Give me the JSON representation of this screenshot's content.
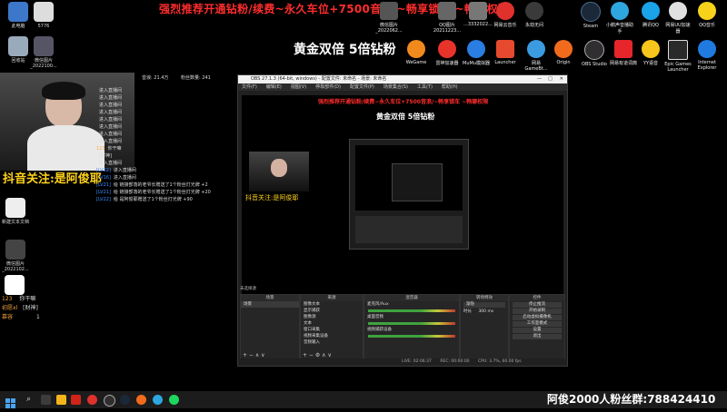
{
  "banner": {
    "line1": "强烈推荐开通钻粉/续费~永久车位+7500音浪/~畅享锁车 ~畅聊权限",
    "line2": "黄金双倍 5倍钻粉",
    "follow": "抖音关注:是阿俊耶",
    "fans": "阿俊2000人粉丝群:788424410"
  },
  "desktop_left": [
    {
      "label": "此电脑",
      "icon": "computer-icon"
    },
    {
      "label": "5776",
      "icon": "file-icon"
    },
    {
      "label": "回收站",
      "icon": "recycle-bin-icon"
    },
    {
      "label": "微信图片_2022100...",
      "icon": "image-icon"
    },
    {
      "label": "新建文本文档",
      "icon": "text-file-icon"
    },
    {
      "label": "微信图片_2022102...",
      "icon": "image-icon"
    }
  ],
  "desktop_top_row": [
    {
      "label": "微信图片_2022062...",
      "icon": "image-icon"
    },
    {
      "label": "QQ图片 20211223...",
      "icon": "image-icon"
    },
    {
      "label": "...3332022...",
      "icon": "image-icon"
    },
    {
      "label": "网易云音乐",
      "icon": "netease-music-icon"
    },
    {
      "label": "永劫无间",
      "icon": "game-icon"
    },
    {
      "label": "Steam",
      "icon": "steam-icon"
    },
    {
      "label": "小鹅声音播助手",
      "icon": "app-icon"
    },
    {
      "label": "腾讯QQ",
      "icon": "qq-icon"
    },
    {
      "label": "网易UU加速器",
      "icon": "uu-icon"
    },
    {
      "label": "QQ音乐",
      "icon": "qq-music-icon"
    }
  ],
  "desktop_second_row": [
    {
      "label": "WeGame",
      "icon": "wegame-icon"
    },
    {
      "label": "雷神加速器",
      "icon": "thunder-icon"
    },
    {
      "label": "MuMu模拟器",
      "icon": "mumu-icon"
    },
    {
      "label": "Launcher",
      "icon": "launcher-icon"
    },
    {
      "label": "网易GameBt...",
      "icon": "game-icon"
    },
    {
      "label": "Origin",
      "icon": "origin-icon"
    },
    {
      "label": "OBS Studio",
      "icon": "obs-icon"
    },
    {
      "label": "网易有道词典",
      "icon": "youdao-icon"
    },
    {
      "label": "YY语音",
      "icon": "yy-icon"
    },
    {
      "label": "Epic Games Launcher",
      "icon": "epic-icon"
    },
    {
      "label": "Internet Explorer",
      "icon": "ie-icon"
    }
  ],
  "stream_stats": {
    "left": "音浪: 21.4万",
    "right": "粉丝数量: 241"
  },
  "chat": [
    {
      "lv": "",
      "name": "",
      "text": "进入直播间"
    },
    {
      "lv": "",
      "name": "",
      "text": "进入直播间"
    },
    {
      "lv": "",
      "name": "",
      "text": "进入直播间"
    },
    {
      "lv": "",
      "name": "",
      "text": "进入直播间"
    },
    {
      "lv": "",
      "name": "",
      "text": "进入直播间"
    },
    {
      "lv": "",
      "name": "",
      "text": "进入直播间"
    },
    {
      "lv": "",
      "name": "",
      "text": "进入直播间"
    },
    {
      "lv": "",
      "name": "",
      "text": "进入直播间"
    },
    {
      "lv": "",
      "name": "123",
      "text": "你干嘛"
    },
    {
      "lv": "",
      "name": "",
      "text": "[财神]"
    },
    {
      "lv": "",
      "name": "",
      "text": "进入直播间"
    },
    {
      "lv": "[LV22]",
      "name": "",
      "text": "进入直播间"
    },
    {
      "lv": "[LV16]",
      "name": "",
      "text": "进入直播间"
    },
    {
      "lv": "[LV21]",
      "name": "",
      "text": "给 链接部落的老爷长赠送了1个粉丝灯光牌 +2"
    },
    {
      "lv": "[LV21]",
      "name": "",
      "text": "给 链接部落的老爷长赠送了1个粉丝灯光牌 +20"
    },
    {
      "lv": "[LV22]",
      "name": "",
      "text": "给 是阿俊耶赠送了1个粉丝灯光牌 +90"
    }
  ],
  "bottom_chat": [
    {
      "name": "123",
      "text": "你干嘛"
    },
    {
      "name": "初愿xl",
      "text": "[财神]"
    },
    {
      "name": "慕容",
      "text": "1"
    }
  ],
  "obs": {
    "title": "OBS 27.1.3 (64-bit, windows) - 配置文件: 未命名 - 场景: 未命名",
    "menu": [
      "文件(F)",
      "编辑(E)",
      "视图(V)",
      "停靠部件(D)",
      "配置文件(P)",
      "场景集合(S)",
      "工具(T)",
      "帮助(H)"
    ],
    "scene_label": "未选择源",
    "docks": {
      "scenes": {
        "title": "场景",
        "items": [
          "场景"
        ]
      },
      "sources": {
        "title": "来源",
        "items": [
          "图像文本",
          "显示捕获",
          "图像源",
          "文本",
          "窗口采集",
          "视频采集设备",
          "音频输入"
        ]
      },
      "mixer": {
        "title": "混音器",
        "items": [
          "麦克风/Aux",
          "桌面音频",
          "视频捕获设备"
        ]
      },
      "transitions": {
        "title": "转场特效",
        "fade": "渐隐",
        "duration_label": "时长",
        "duration": "300 ms"
      },
      "controls": {
        "title": "控件",
        "buttons": [
          "停止推流",
          "开始录制",
          "启动虚拟摄像机",
          "工作室模式",
          "设置",
          "退出"
        ]
      }
    },
    "status": {
      "live": "LIVE: 02:06:37",
      "rec": "REC: 00:00:00",
      "cpu": "CPU: 3.7%, 60.00 fps"
    }
  },
  "taskbar": {
    "search": "搜索"
  }
}
